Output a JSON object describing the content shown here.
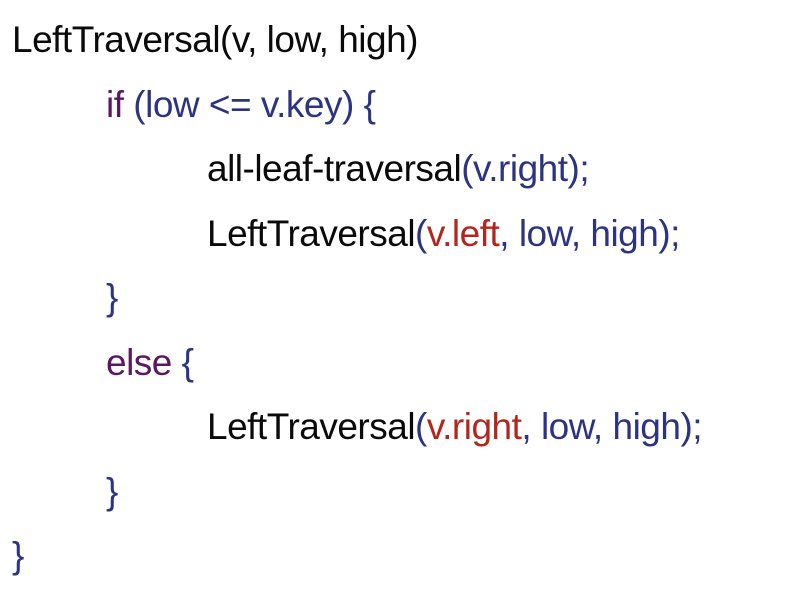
{
  "document": {
    "colors": {
      "default": "#0a0a0a",
      "identifier": "#2b3382",
      "keyword": "#5b1762",
      "highlight": "#b3261e"
    },
    "lines": [
      {
        "indent": 0,
        "tokens": [
          {
            "text": "LeftTraversal(v, low, high)",
            "color": "black"
          }
        ]
      },
      {
        "indent": 1,
        "tokens": [
          {
            "text": "if",
            "color": "purple"
          },
          {
            "text": " (low <= v.key) {",
            "color": "blue"
          }
        ]
      },
      {
        "indent": 2,
        "tokens": [
          {
            "text": "all-leaf-traversal",
            "color": "black"
          },
          {
            "text": "(v.right);",
            "color": "blue"
          }
        ]
      },
      {
        "indent": 2,
        "tokens": [
          {
            "text": "LeftTraversal",
            "color": "black"
          },
          {
            "text": "(",
            "color": "blue"
          },
          {
            "text": "v.left",
            "color": "red"
          },
          {
            "text": ", low, high);",
            "color": "blue"
          }
        ]
      },
      {
        "indent": 1,
        "tokens": [
          {
            "text": "}",
            "color": "blue"
          }
        ]
      },
      {
        "indent": 1,
        "tokens": [
          {
            "text": "else",
            "color": "purple"
          },
          {
            "text": " {",
            "color": "blue"
          }
        ]
      },
      {
        "indent": 2,
        "tokens": [
          {
            "text": "LeftTraversal",
            "color": "black"
          },
          {
            "text": "(",
            "color": "blue"
          },
          {
            "text": "v.right",
            "color": "red"
          },
          {
            "text": ", low, high);",
            "color": "blue"
          }
        ]
      },
      {
        "indent": 1,
        "tokens": [
          {
            "text": "}",
            "color": "blue"
          }
        ]
      },
      {
        "indent": 0,
        "tokens": [
          {
            "text": "}",
            "color": "blue"
          }
        ]
      }
    ]
  }
}
